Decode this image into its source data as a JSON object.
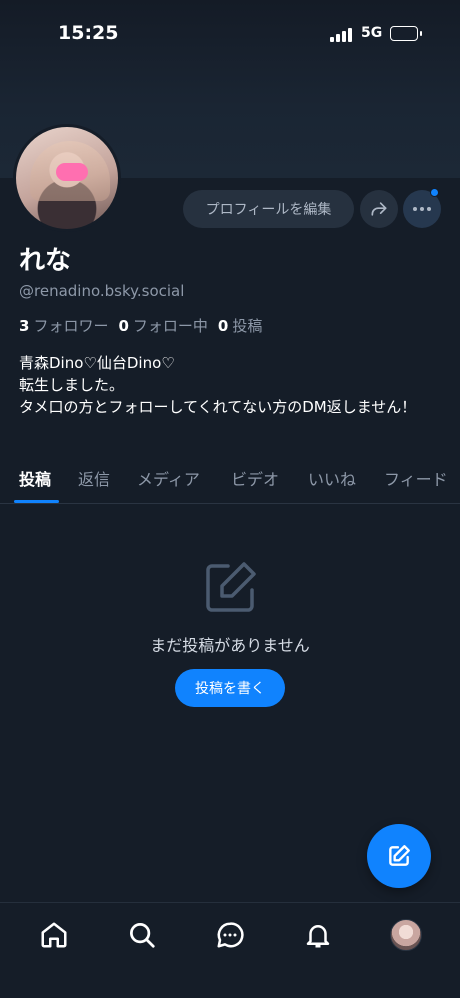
{
  "status_bar": {
    "time": "15:25",
    "network": "5G"
  },
  "profile": {
    "display_name": "れな",
    "handle": "@renadino.bsky.social",
    "followers_count": "3",
    "followers_label": "フォロワー",
    "following_count": "0",
    "following_label": "フォロー中",
    "posts_count": "0",
    "posts_label": "投稿",
    "bio_lines": [
      "青森Dino♡仙台Dino♡",
      "転生しました。",
      "タメ口の方とフォローしてくれてない方のDM返しません！"
    ]
  },
  "actions": {
    "edit_profile": "プロフィールを編集"
  },
  "tabs": [
    "投稿",
    "返信",
    "メディア",
    "ビデオ",
    "いいね",
    "フィード"
  ],
  "active_tab": "投稿",
  "empty_state": {
    "message": "まだ投稿がありません",
    "button": "投稿を書く"
  },
  "colors": {
    "accent": "#1083fe",
    "background": "#151d28",
    "muted_text": "#8d98a8"
  },
  "icons": {
    "share": "share-arrow-icon",
    "more": "ellipsis-icon",
    "compose": "pencil-square-icon",
    "nav": [
      "home-icon",
      "search-icon",
      "chat-icon",
      "bell-icon",
      "profile-avatar"
    ]
  }
}
